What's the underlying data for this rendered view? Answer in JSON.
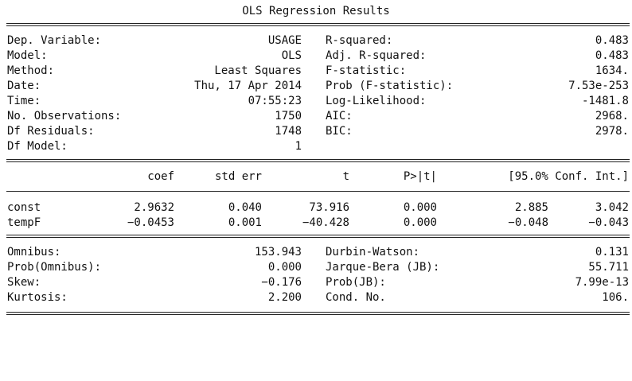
{
  "title": "OLS Regression Results",
  "model_info": {
    "left": [
      {
        "label": "Dep. Variable:",
        "value": "USAGE"
      },
      {
        "label": "Model:",
        "value": "OLS"
      },
      {
        "label": "Method:",
        "value": "Least Squares"
      },
      {
        "label": "Date:",
        "value": "Thu, 17 Apr 2014"
      },
      {
        "label": "Time:",
        "value": "07:55:23"
      },
      {
        "label": "No. Observations:",
        "value": "1750"
      },
      {
        "label": "Df Residuals:",
        "value": "1748"
      },
      {
        "label": "Df Model:",
        "value": "1"
      }
    ],
    "right": [
      {
        "label": "R-squared:",
        "value": "0.483"
      },
      {
        "label": "Adj. R-squared:",
        "value": "0.483"
      },
      {
        "label": "F-statistic:",
        "value": "1634."
      },
      {
        "label": "Prob (F-statistic):",
        "value": "7.53e-253"
      },
      {
        "label": "Log-Likelihood:",
        "value": "-1481.8"
      },
      {
        "label": "AIC:",
        "value": "2968."
      },
      {
        "label": "BIC:",
        "value": "2978."
      }
    ]
  },
  "coef_table": {
    "headers": [
      "coef",
      "std err",
      "t",
      "P>|t|",
      "[95.0% Conf. Int.]"
    ],
    "rows": [
      {
        "name": "const",
        "coef": "2.9632",
        "std_err": "0.040",
        "t": "73.916",
        "p": "0.000",
        "ci_low": "2.885",
        "ci_high": "3.042"
      },
      {
        "name": "tempF",
        "coef": "−0.0453",
        "std_err": "0.001",
        "t": "−40.428",
        "p": "0.000",
        "ci_low": "−0.048",
        "ci_high": "−0.043"
      }
    ]
  },
  "diagnostics": {
    "left": [
      {
        "label": "Omnibus:",
        "value": "153.943"
      },
      {
        "label": "Prob(Omnibus):",
        "value": "0.000"
      },
      {
        "label": "Skew:",
        "value": "−0.176"
      },
      {
        "label": "Kurtosis:",
        "value": "2.200"
      }
    ],
    "right": [
      {
        "label": "Durbin-Watson:",
        "value": "0.131"
      },
      {
        "label": "Jarque-Bera (JB):",
        "value": "55.711"
      },
      {
        "label": "Prob(JB):",
        "value": "7.99e-13"
      },
      {
        "label": "Cond. No.",
        "value": "106."
      }
    ]
  }
}
